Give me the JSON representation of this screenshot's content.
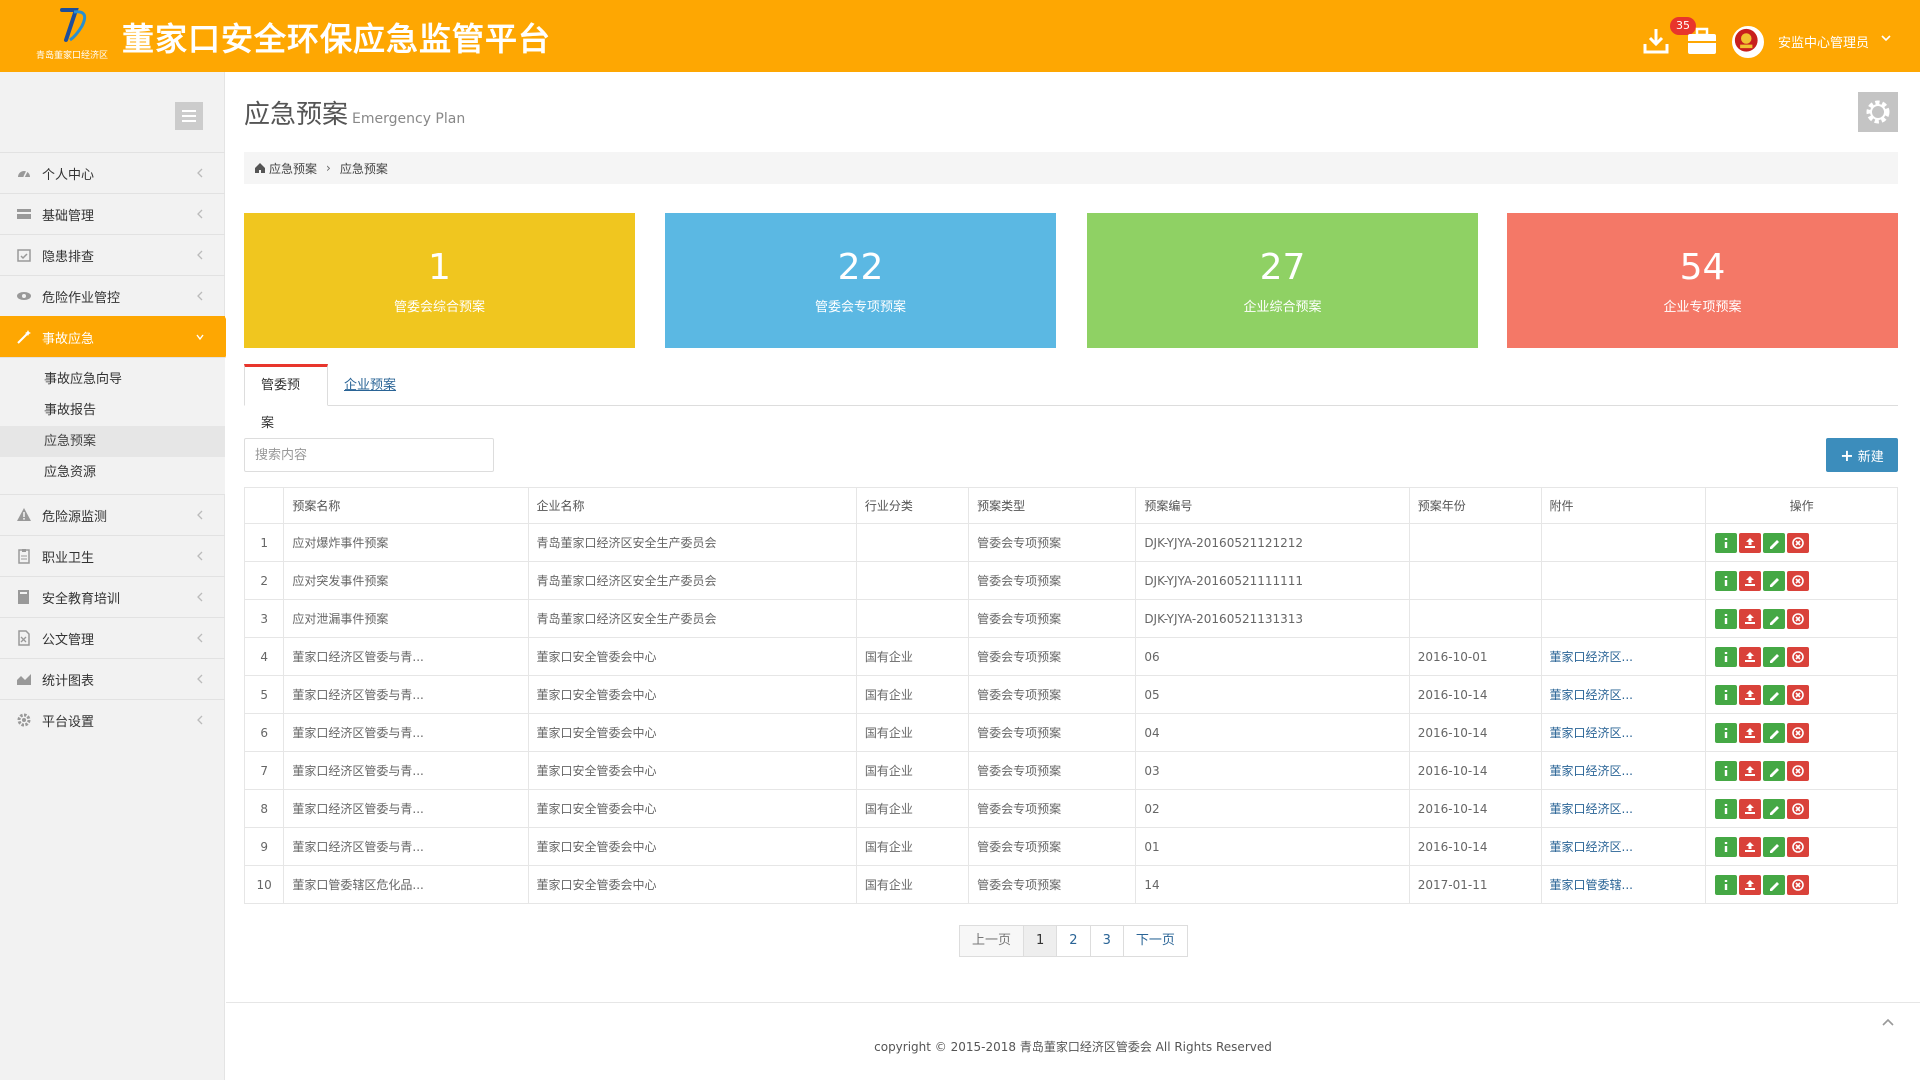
{
  "header": {
    "logo_sub": "青岛董家口经济区",
    "title": "董家口安全环保应急监管平台",
    "badge_count": "35",
    "user_name": "安监中心管理员"
  },
  "colors": {
    "header_bg": "#fea702",
    "stat_yellow": "#f0c61f",
    "stat_blue": "#5bb8e3",
    "stat_green": "#8fd164",
    "stat_red": "#f47867",
    "primary": "#3c8dbc"
  },
  "sidebar": {
    "items": [
      {
        "label": "个人中心",
        "icon": "dashboard-icon"
      },
      {
        "label": "基础管理",
        "icon": "stack-icon"
      },
      {
        "label": "隐患排查",
        "icon": "calendar-check-icon"
      },
      {
        "label": "危险作业管控",
        "icon": "eye-icon"
      },
      {
        "label": "事故应急",
        "icon": "magic-wand-icon",
        "active": true
      },
      {
        "label": "危险源监测",
        "icon": "warning-icon"
      },
      {
        "label": "职业卫生",
        "icon": "clipboard-icon"
      },
      {
        "label": "安全教育培训",
        "icon": "book-icon"
      },
      {
        "label": "公文管理",
        "icon": "document-icon"
      },
      {
        "label": "统计图表",
        "icon": "area-chart-icon"
      },
      {
        "label": "平台设置",
        "icon": "gear-icon"
      }
    ],
    "submenu": [
      "事故应急向导",
      "事故报告",
      "应急预案",
      "应急资源"
    ],
    "submenu_selected": 2
  },
  "page": {
    "title": "应急预案",
    "subtitle": "Emergency Plan",
    "breadcrumb": [
      "应急预案",
      "应急预案"
    ]
  },
  "stats": [
    {
      "value": "1",
      "label": "管委会综合预案"
    },
    {
      "value": "22",
      "label": "管委会专项预案"
    },
    {
      "value": "27",
      "label": "企业综合预案"
    },
    {
      "value": "54",
      "label": "企业专项预案"
    }
  ],
  "tabs": [
    "管委预案",
    "企业预案"
  ],
  "search": {
    "placeholder": "搜索内容"
  },
  "new_button": "新建",
  "table": {
    "columns": [
      "",
      "预案名称",
      "企业名称",
      "行业分类",
      "预案类型",
      "预案编号",
      "预案年份",
      "附件",
      "操作"
    ],
    "rows": [
      [
        "1",
        "应对爆炸事件预案",
        "青岛董家口经济区安全生产委员会",
        "",
        "管委会专项预案",
        "DJK-YJYA-20160521121212",
        "",
        ""
      ],
      [
        "2",
        "应对突发事件预案",
        "青岛董家口经济区安全生产委员会",
        "",
        "管委会专项预案",
        "DJK-YJYA-20160521111111",
        "",
        ""
      ],
      [
        "3",
        "应对泄漏事件预案",
        "青岛董家口经济区安全生产委员会",
        "",
        "管委会专项预案",
        "DJK-YJYA-20160521131313",
        "",
        ""
      ],
      [
        "4",
        "董家口经济区管委与青...",
        "董家口安全管委会中心",
        "国有企业",
        "管委会专项预案",
        "06",
        "2016-10-01",
        "董家口经济区..."
      ],
      [
        "5",
        "董家口经济区管委与青...",
        "董家口安全管委会中心",
        "国有企业",
        "管委会专项预案",
        "05",
        "2016-10-14",
        "董家口经济区..."
      ],
      [
        "6",
        "董家口经济区管委与青...",
        "董家口安全管委会中心",
        "国有企业",
        "管委会专项预案",
        "04",
        "2016-10-14",
        "董家口经济区..."
      ],
      [
        "7",
        "董家口经济区管委与青...",
        "董家口安全管委会中心",
        "国有企业",
        "管委会专项预案",
        "03",
        "2016-10-14",
        "董家口经济区..."
      ],
      [
        "8",
        "董家口经济区管委与青...",
        "董家口安全管委会中心",
        "国有企业",
        "管委会专项预案",
        "02",
        "2016-10-14",
        "董家口经济区..."
      ],
      [
        "9",
        "董家口经济区管委与青...",
        "董家口安全管委会中心",
        "国有企业",
        "管委会专项预案",
        "01",
        "2016-10-14",
        "董家口经济区..."
      ],
      [
        "10",
        "董家口管委辖区危化品...",
        "董家口安全管委会中心",
        "国有企业",
        "管委会专项预案",
        "14",
        "2017-01-11",
        "董家口管委辖..."
      ]
    ]
  },
  "pagination": {
    "prev": "上一页",
    "pages": [
      "1",
      "2",
      "3"
    ],
    "current": 0,
    "next": "下一页"
  },
  "footer": "copyright © 2015-2018 青岛董家口经济区管委会 All Rights Reserved"
}
